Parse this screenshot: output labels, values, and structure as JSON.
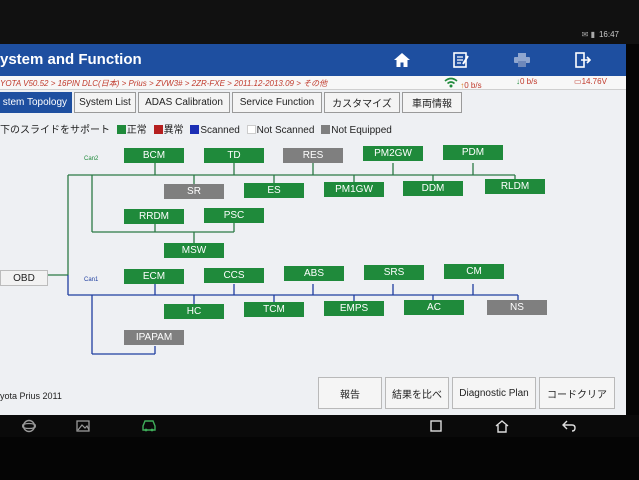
{
  "status_bar": {
    "time": "16:47"
  },
  "header": {
    "title": "ystem and Function",
    "buttons": [
      "home-icon",
      "report-icon",
      "print-icon",
      "exit-icon"
    ]
  },
  "vehicle_info": {
    "path": "YOTA V50.52 > 16PIN DLC(日本) > Prius > ZVW3# > 2ZR-FXE > 2011.12-2013.09 > その他",
    "wifi_speed": "0 b/s",
    "down_speed": "0 b/s",
    "voltage": "14.76V"
  },
  "tabs": [
    "stem Topology",
    "System List",
    "ADAS Calibration",
    "Service Function",
    "カスタマイズ",
    "車両情報"
  ],
  "legend": {
    "prefix": "下のスライドをサポート",
    "items": [
      {
        "label": "正常",
        "color": "#1f8a3b"
      },
      {
        "label": "異常",
        "color": "#b51f1f"
      },
      {
        "label": "Scanned",
        "color": "#1c2fb5"
      },
      {
        "label": "Not Scanned",
        "color": "#ffffff"
      },
      {
        "label": "Not Equipped",
        "color": "#7f7f7f"
      }
    ]
  },
  "diagram": {
    "obd_label": "OBD",
    "can2_label": "Can2",
    "can1_label": "Can1",
    "can2_top": [
      "BCM",
      "TD",
      "RES",
      "PM2GW",
      "PDM"
    ],
    "can2_top_status": [
      "green",
      "green",
      "gray",
      "green",
      "green"
    ],
    "can2_bottom": [
      "SR",
      "ES",
      "PM1GW",
      "DDM",
      "RLDM"
    ],
    "can2_bottom_status": [
      "gray",
      "green",
      "green",
      "green",
      "green"
    ],
    "sub1": [
      "RRDM",
      "PSC"
    ],
    "msw": "MSW",
    "can1_top": [
      "ECM",
      "CCS",
      "ABS",
      "SRS",
      "CM"
    ],
    "can1_bottom": [
      "HC",
      "TCM",
      "EMPS",
      "AC",
      "NS"
    ],
    "can1_bottom_status": [
      "green",
      "green",
      "green",
      "green",
      "gray"
    ],
    "ipapam": "IPAPAM"
  },
  "footer": {
    "vehicle": "yota Prius 2011",
    "buttons": [
      "報告",
      "結果を比べ",
      "Diagnostic Plan",
      "コードクリア"
    ]
  },
  "colors": {
    "header_blue": "#1e4fa0",
    "ok_green": "#1f8a3b",
    "not_equipped_gray": "#7f7f7f",
    "can1_line_blue": "#1f3fa0",
    "can2_line_green": "#2c7a46"
  }
}
